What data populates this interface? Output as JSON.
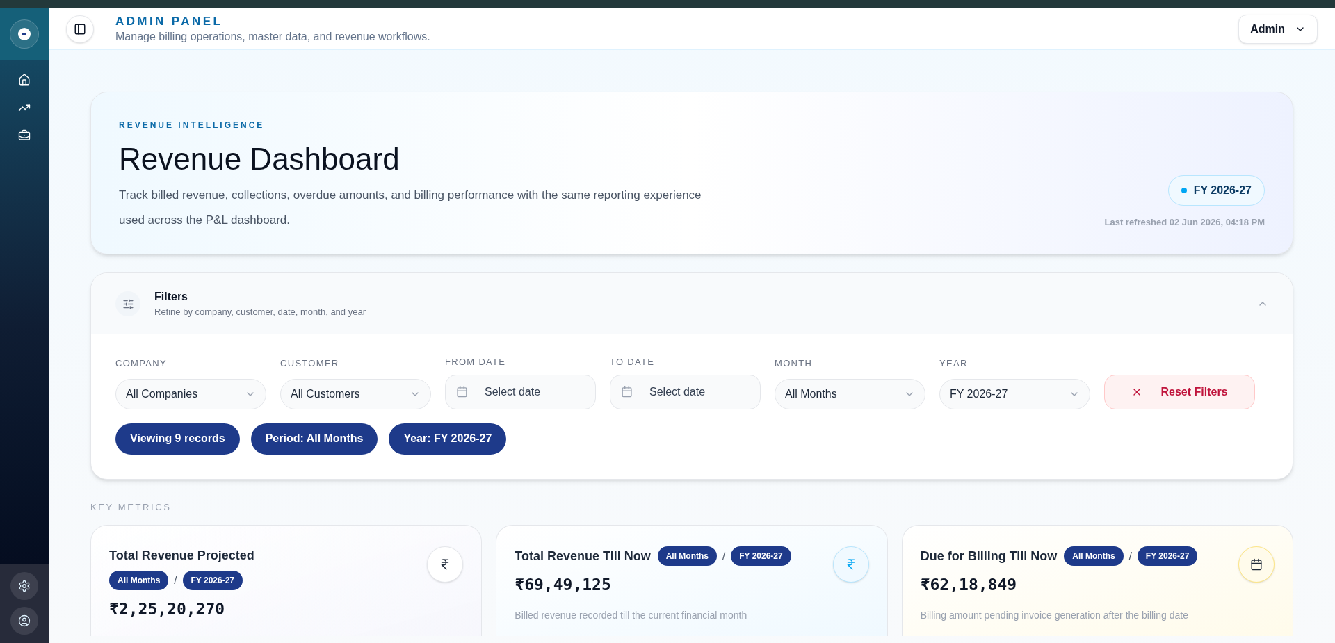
{
  "header": {
    "title": "ADMIN PANEL",
    "subtitle": "Manage billing operations, master data, and revenue workflows.",
    "user_menu": "Admin"
  },
  "sidebar": {
    "items": [
      {
        "kind": "home"
      },
      {
        "kind": "trend"
      },
      {
        "kind": "briefcase"
      }
    ],
    "footer_items": [
      {
        "kind": "settings"
      },
      {
        "kind": "profile"
      }
    ]
  },
  "hero": {
    "eyebrow": "REVENUE INTELLIGENCE",
    "title": "Revenue Dashboard",
    "description": "Track billed revenue, collections, overdue amounts, and billing performance with the same reporting experience used across the P&L dashboard.",
    "badge": "FY 2026-27",
    "refreshed": "Last refreshed 02 Jun 2026, 04:18 PM"
  },
  "filters": {
    "title": "Filters",
    "subtitle": "Refine by company, customer, date, month, and year",
    "expanded": true,
    "fields": [
      {
        "kind": "select",
        "label": "COMPANY",
        "value": "All Companies"
      },
      {
        "kind": "select",
        "label": "CUSTOMER",
        "value": "All Customers"
      },
      {
        "kind": "date",
        "label": "FROM DATE",
        "placeholder": "Select date"
      },
      {
        "kind": "date",
        "label": "TO DATE",
        "placeholder": "Select date"
      },
      {
        "kind": "select",
        "label": "MONTH",
        "value": "All Months"
      },
      {
        "kind": "select",
        "label": "YEAR",
        "value": "FY 2026-27"
      }
    ],
    "reset_button": "Reset Filters",
    "chips": [
      "Viewing 9 records",
      "Period: All Months",
      "Year: FY 2026-27"
    ]
  },
  "key_metrics": {
    "label": "KEY METRICS",
    "cards": [
      {
        "title": "Total Revenue Projected",
        "period": "All Months",
        "separator": "/",
        "year": "FY 2026-27",
        "value": "₹2,25,20,270",
        "kind": "projected"
      },
      {
        "title": "Total Revenue Till Now",
        "period": "All Months",
        "separator": "/",
        "year": "FY 2026-27",
        "value": "₹69,49,125",
        "description": "Billed revenue recorded till the current financial month",
        "kind": "billed"
      },
      {
        "title": "Due for Billing Till Now",
        "period": "All Months",
        "separator": "/",
        "year": "FY 2026-27",
        "value": "₹62,18,849",
        "description": "Billing amount pending invoice generation after the billing date",
        "kind": "due"
      }
    ]
  }
}
